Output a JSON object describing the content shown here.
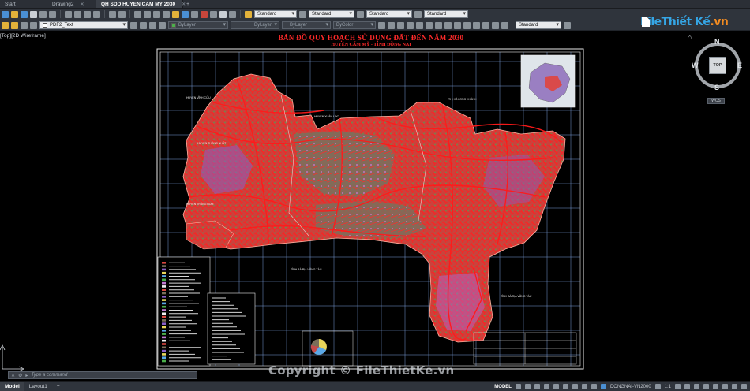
{
  "tabs": [
    {
      "label": "Start",
      "active": false
    },
    {
      "label": "Drawing2",
      "active": false
    },
    {
      "label": "QH SDD HUYEN CAM MY 2030",
      "active": true
    }
  ],
  "toolbar": {
    "text_style": "Standard",
    "dim_style": "Standard",
    "table_style": "Standard",
    "mleader_style": "Standard",
    "layer": "PDF2_Text",
    "color": "ByLayer",
    "linetype": "ByLayer",
    "lineweight": "ByLayer",
    "plot_style": "ByColor",
    "visual_style": "Standard"
  },
  "viewport": {
    "label": "[Top][2D Wireframe]"
  },
  "map": {
    "title": "BẢN ĐỒ QUY HOẠCH SỬ DỤNG ĐẤT ĐẾN NĂM 2030",
    "subtitle": "HUYỆN CẨM MỸ - TỈNH ĐỒNG NAI",
    "labels": {
      "vinh_cuu": "HUYỆN VĨNH CỬU",
      "long_khanh": "THỊ XÃ LONG KHÁNH",
      "xuan_loc": "HUYỆN XUÂN LỘC",
      "trang_bom": "HUYỆN TRẢNG BOM",
      "thong_nhat": "HUYỆN THỐNG NHẤT",
      "ba_ria_1": "TỈNH BÀ RỊA VŨNG TÀU",
      "ba_ria_2": "TỈNH BÀ RỊA VŨNG TÀU"
    },
    "colors": {
      "grid": "#8fb8ff",
      "land_primary": "#d9463f",
      "land_dark": "#7a6e5a",
      "land_purple": "#8a5ec7",
      "roads": "#ff1a1a",
      "frame": "#e8e8e8"
    }
  },
  "watermark": {
    "logo_text": "FileThiết Kế",
    "logo_suffix": ".vn",
    "copyright": "Copyright © FileThietKe.vn"
  },
  "navigation": {
    "north": "N",
    "south": "S",
    "east": "E",
    "west": "W",
    "cube_face": "TOP",
    "wcs": "WCS",
    "home_icon": "home-icon"
  },
  "command": {
    "placeholder": "Type a command",
    "close": "✕"
  },
  "status": {
    "layout_tabs": [
      "Model",
      "Layout1"
    ],
    "mode": "MODEL",
    "coordinate_system": "DONGNAI-VN2000",
    "scale": "1:1"
  }
}
